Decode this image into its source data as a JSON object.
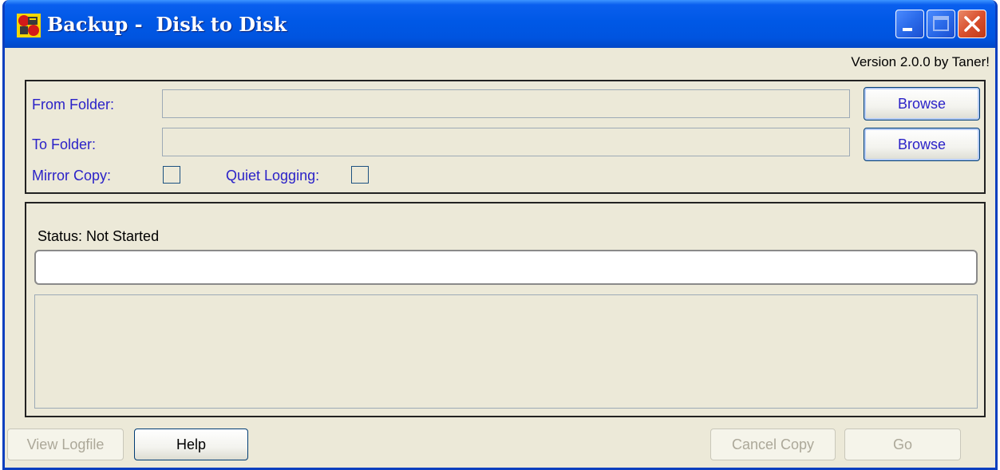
{
  "window": {
    "title": "Backup -  Disk to Disk",
    "version": "Version 2.0.0 by Taner!"
  },
  "source": {
    "label": "From Folder:",
    "value": "",
    "browse_label": "Browse"
  },
  "destination": {
    "label": "To Folder:",
    "value": "",
    "browse_label": "Browse"
  },
  "options": {
    "mirror_label": "Mirror Copy:",
    "mirror_checked": false,
    "quiet_label": "Quiet Logging:",
    "quiet_checked": false
  },
  "status": {
    "text": "Status: Not Started",
    "progress": 0,
    "log": ""
  },
  "buttons": {
    "view_logfile": "View Logfile",
    "help": "Help",
    "cancel_copy": "Cancel Copy",
    "go": "Go"
  },
  "colors": {
    "titlebar": "#0054E3",
    "face": "#ECE9D8",
    "label_blue": "#2B22C8",
    "disabled_text": "#ACA899"
  },
  "icons": [
    "app-icon",
    "minimize-icon",
    "maximize-icon",
    "close-icon"
  ]
}
